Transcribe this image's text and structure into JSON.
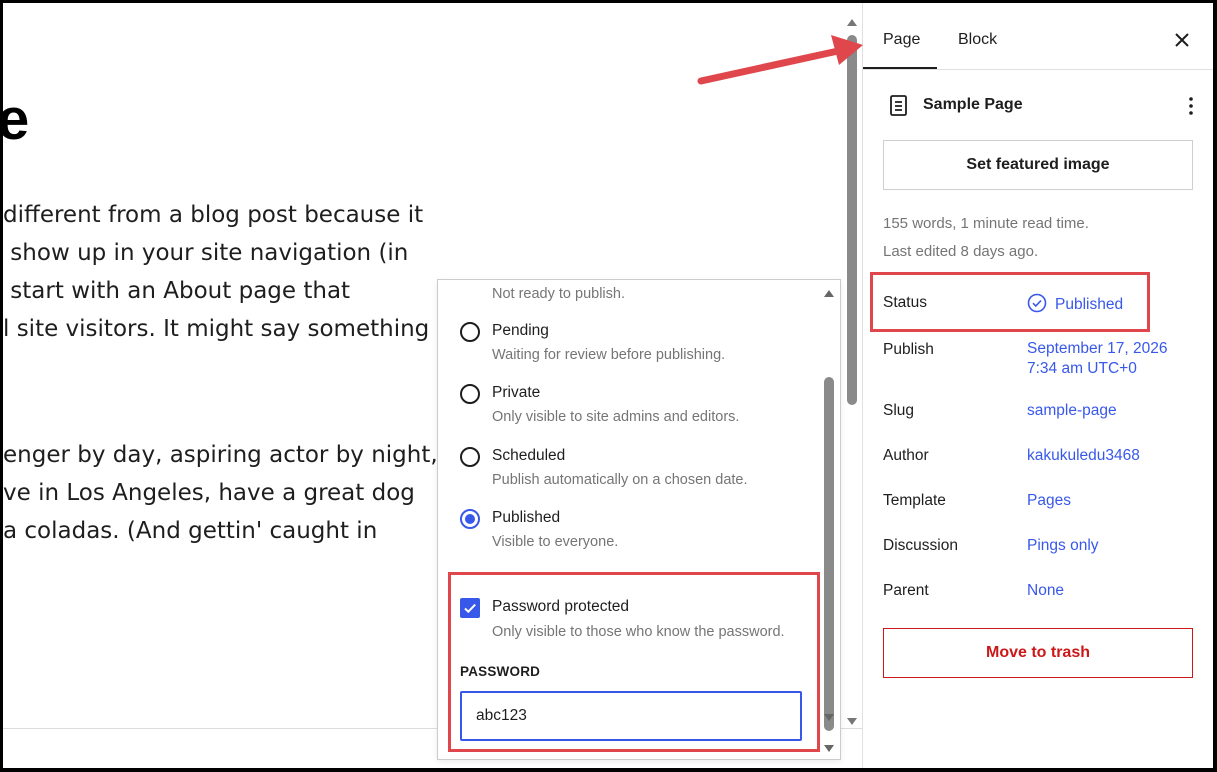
{
  "canvas": {
    "title_fragment": "e",
    "para1": [
      "different from a blog post because it",
      " show up in your site navigation (in",
      " start with an About page that",
      "l site visitors. It might say something"
    ],
    "para2": [
      "enger by day, aspiring actor by night,",
      "ve in Los Angeles, have a great dog",
      "a coladas. (And gettin' caught in"
    ]
  },
  "sidebar": {
    "tabs": [
      {
        "label": "Page",
        "active": true
      },
      {
        "label": "Block",
        "active": false
      }
    ],
    "close_icon": "close-icon",
    "doc_title": "Sample Page",
    "featured_image_label": "Set featured image",
    "word_count": "155 words, 1 minute read time.",
    "last_edited": "Last edited 8 days ago.",
    "rows": {
      "status": {
        "label": "Status",
        "value": "Published"
      },
      "publish": {
        "label": "Publish",
        "value_line1": "September 17, 2026",
        "value_line2": "7:34 am UTC+0"
      },
      "slug": {
        "label": "Slug",
        "value": "sample-page"
      },
      "author": {
        "label": "Author",
        "value": "kakukuledu3468"
      },
      "template": {
        "label": "Template",
        "value": "Pages"
      },
      "discussion": {
        "label": "Discussion",
        "value": "Pings only"
      },
      "parent": {
        "label": "Parent",
        "value": "None"
      }
    },
    "trash_label": "Move to trash"
  },
  "status_popover": {
    "draft_help": "Not ready to publish.",
    "options": [
      {
        "label": "Pending",
        "help": "Waiting for review before publishing.",
        "checked": false
      },
      {
        "label": "Private",
        "help": "Only visible to site admins and editors.",
        "checked": false
      },
      {
        "label": "Scheduled",
        "help": "Publish automatically on a chosen date.",
        "checked": false
      },
      {
        "label": "Published",
        "help": "Visible to everyone.",
        "checked": true
      }
    ],
    "password_protected": {
      "label": "Password protected",
      "help": "Only visible to those who know the password.",
      "checked": true
    },
    "password_title": "PASSWORD",
    "password_value": "abc123"
  },
  "colors": {
    "accent": "#3858e9",
    "highlight": "#e0474c",
    "danger": "#cc1818"
  }
}
